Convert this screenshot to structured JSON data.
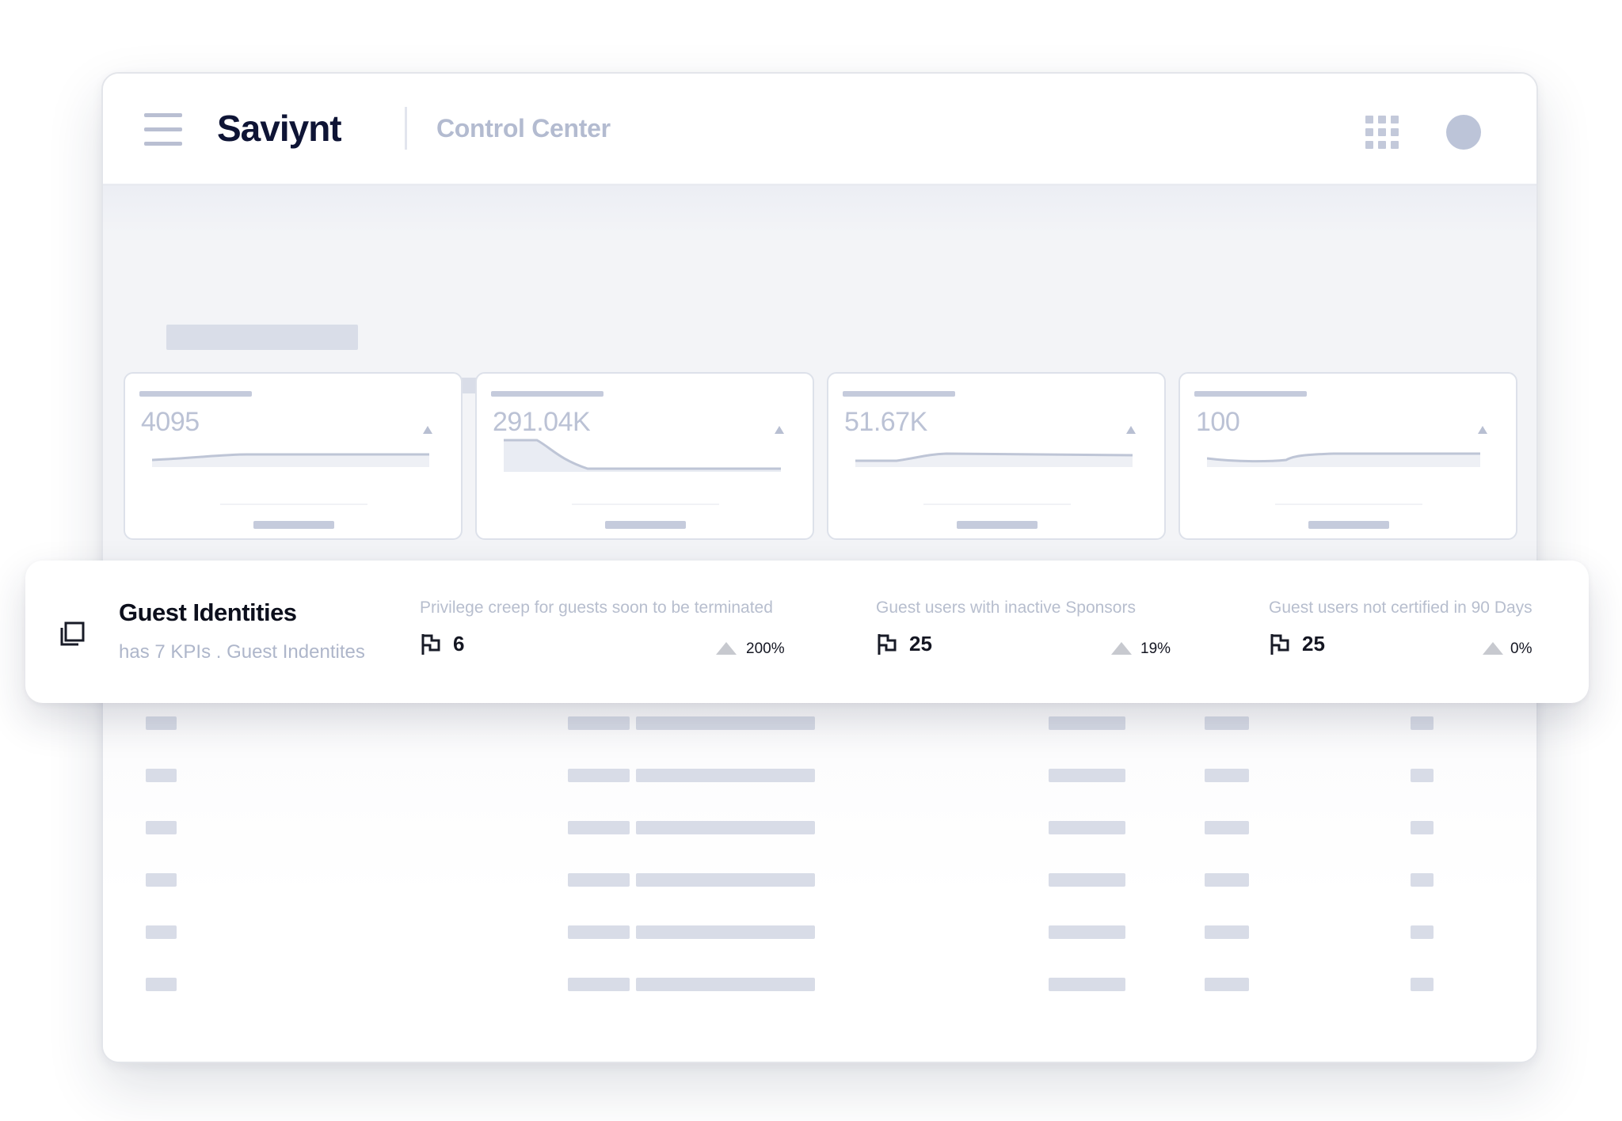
{
  "header": {
    "logo": "Saviynt",
    "app_title": "Control Center"
  },
  "kpi_cards": [
    {
      "value": "4095"
    },
    {
      "value": "291.04K"
    },
    {
      "value": "51.67K"
    },
    {
      "value": "100"
    }
  ],
  "overlay": {
    "title": "Guest Identities",
    "subtitle": "has 7 KPIs . Guest Indentites",
    "kpis": [
      {
        "label": "Privilege creep for guests soon to be terminated",
        "value": "6",
        "change": "200%"
      },
      {
        "label": "Guest users with inactive Sponsors",
        "value": "25",
        "change": "19%"
      },
      {
        "label": "Guest users not certified in 90 Days",
        "value": "25",
        "change": "0%"
      }
    ]
  },
  "icons": {
    "menu": "hamburger-icon",
    "apps": "grid-icon",
    "card": "copy-icon",
    "kpi": "flag-icon",
    "trend": "triangle-up-icon"
  }
}
